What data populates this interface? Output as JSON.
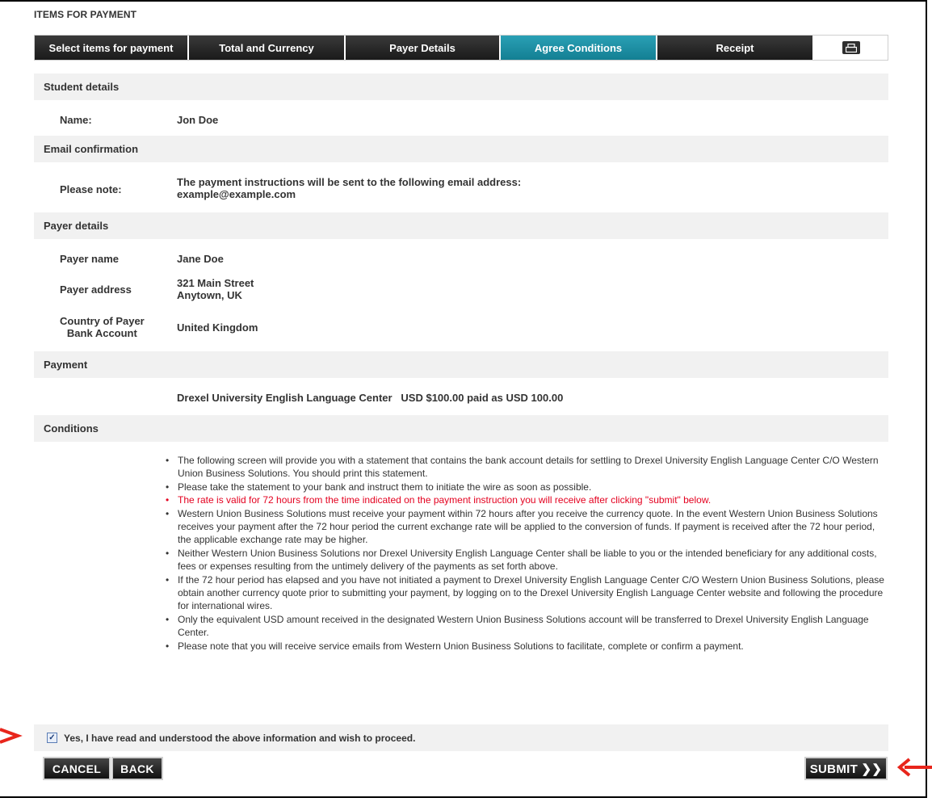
{
  "page_title": "ITEMS FOR PAYMENT",
  "steps": [
    {
      "label": "Select items for payment"
    },
    {
      "label": "Total and Currency"
    },
    {
      "label": "Payer Details"
    },
    {
      "label": "Agree Conditions"
    },
    {
      "label": "Receipt"
    }
  ],
  "active_step": "Agree Conditions",
  "print_icon": "printer-icon",
  "sections": {
    "student": "Student details",
    "email": "Email confirmation",
    "payer": "Payer details",
    "payment": "Payment",
    "conditions": "Conditions"
  },
  "student": {
    "name_label": "Name:",
    "name_value": "Jon Doe"
  },
  "email": {
    "note_label": "Please note:",
    "note_line1": "The payment instructions will be sent to the following email address:",
    "note_line2": "example@example.com"
  },
  "payer": {
    "name_label": "Payer name",
    "name_value": "Jane Doe",
    "address_label": "Payer address",
    "address_line1": "321 Main Street",
    "address_line2": "Anytown, UK",
    "country_label_1": "Country of Payer",
    "country_label_2": "Bank Account",
    "country_value": "United Kingdom"
  },
  "payment": {
    "line": "Drexel University English Language Center   USD $100.00 paid as USD 100.00"
  },
  "conditions": [
    "The following screen will provide you with a statement that contains the bank account details for settling to Drexel University English Language Center C/O Western Union Business Solutions. You should print this statement.",
    "Please take the statement to your bank and instruct them to initiate the wire as soon as possible.",
    "The rate is valid for 72 hours from the time indicated on the payment instruction you will receive after clicking \"submit\" below.",
    "Western Union Business Solutions must receive your payment within 72 hours after you receive the currency quote. In the event Western Union Business Solutions receives your payment after the 72 hour period the current exchange rate will be applied to the conversion of funds. If payment is received after the 72 hour period, the applicable exchange rate may be higher.",
    "Neither Western Union Business Solutions nor Drexel University English Language Center shall be liable to you or the intended beneficiary for any additional costs, fees or expenses resulting from the untimely delivery of the payments as set forth above.",
    "If the 72 hour period has elapsed and you have not initiated a payment to Drexel University English Language Center C/O Western Union Business Solutions, please obtain another currency quote prior to submitting your payment, by logging on to the Drexel University English Language Center website and following the procedure for international wires.",
    "Only the equivalent USD amount received in the designated Western Union Business Solutions account will be transferred to Drexel University English Language Center.",
    "Please note that you will receive service emails from Western Union Business Solutions to facilitate, complete or confirm a payment."
  ],
  "agree": {
    "checked": true,
    "label": "Yes, I have read and understood the above information and wish to proceed."
  },
  "buttons": {
    "cancel": "CANCEL",
    "back": "BACK",
    "submit": "SUBMIT ❯❯"
  },
  "colors": {
    "active_step": "#1a8ea2",
    "dark_step": "#222222",
    "warning_text": "#e4001f",
    "annotation_arrow": "#e8251b"
  }
}
